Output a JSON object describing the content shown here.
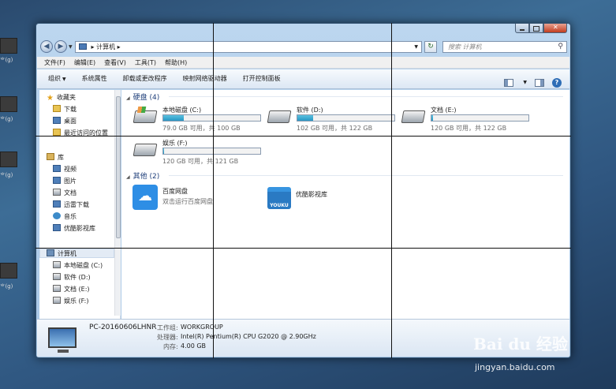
{
  "desktop": {
    "icon_labels": [
      "ᄒ(g)",
      "ᄒ(g)",
      "ᄒ(g)",
      "ᄒ(g)"
    ]
  },
  "window": {
    "address_path": "计算机",
    "address_arrow": "▸",
    "search_placeholder": "搜索 计算机",
    "menu": [
      "文件(F)",
      "编辑(E)",
      "查看(V)",
      "工具(T)",
      "帮助(H)"
    ],
    "commands": [
      "组织",
      "系统属性",
      "卸载或更改程序",
      "映射网络驱动器",
      "打开控制面板"
    ],
    "help_glyph": "?"
  },
  "nav": {
    "favorites": "收藏夹",
    "fav_items": [
      "下载",
      "桌面",
      "最近访问的位置"
    ],
    "libraries": "库",
    "lib_items": [
      "视频",
      "图片",
      "文档",
      "迅雷下载",
      "音乐",
      "优酷影视库"
    ],
    "computer": "计算机",
    "pc_items": [
      "本地磁盘 (C:)",
      "软件 (D:)",
      "文档 (E:)",
      "娱乐 (F:)"
    ]
  },
  "content": {
    "group_drives": "硬盘 (4)",
    "group_other": "其他 (2)",
    "drives": [
      {
        "name": "本地磁盘 (C:)",
        "free": "79.0 GB 可用，共 100 GB",
        "used_fraction": 0.21
      },
      {
        "name": "软件 (D:)",
        "free": "102 GB 可用，共 122 GB",
        "used_fraction": 0.16
      },
      {
        "name": "文档 (E:)",
        "free": "120 GB 可用，共 122 GB",
        "used_fraction": 0.02
      },
      {
        "name": "娱乐 (F:)",
        "free": "120 GB 可用，共 121 GB",
        "used_fraction": 0.01
      }
    ],
    "others": [
      {
        "name": "百度网盘",
        "desc": "双击运行百度网盘"
      },
      {
        "name": "优酷影视库",
        "desc": ""
      }
    ],
    "youku_badge": "YOUKU"
  },
  "details": {
    "pc_name": "PC-20160606LHNR",
    "workgroup_label": "工作组:",
    "workgroup": "WORKGROUP",
    "cpu_label": "处理器:",
    "cpu": "Intel(R) Pentium(R) CPU G2020 @ 2.90GHz",
    "mem_label": "内存:",
    "mem": "4.00 GB"
  },
  "watermark": {
    "logo": "Bai du 经验",
    "url": "jingyan.baidu.com"
  }
}
